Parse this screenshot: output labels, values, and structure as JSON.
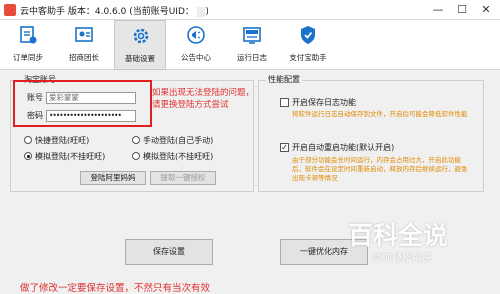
{
  "window": {
    "title": "云中客助手 版本：4.0.6.0 (当前账号UID：",
    "uid_blur": "...",
    "minimize": "—",
    "maximize": "☐",
    "close": "✕"
  },
  "tabs": [
    {
      "label": "订单同步",
      "icon": "order-sync-icon"
    },
    {
      "label": "招商团长",
      "icon": "merchant-leader-icon"
    },
    {
      "label": "基础设置",
      "icon": "settings-gear-icon",
      "active": true
    },
    {
      "label": "公告中心",
      "icon": "announcement-icon"
    },
    {
      "label": "运行日志",
      "icon": "run-log-icon"
    },
    {
      "label": "支付宝助手",
      "icon": "alipay-shield-icon"
    }
  ],
  "login": {
    "group_title": "淘宝账号",
    "account_label": "账号",
    "account_value": "爱彩蒙蒙",
    "password_label": "密码",
    "password_value": "•••••••••••••••••••••",
    "annotation": "如果出现无法登陆的问题，请更换登陆方式尝试"
  },
  "login_modes": [
    {
      "label": "快捷登陆(旺旺)",
      "selected": false
    },
    {
      "label": "手动登陆(自己手动)",
      "selected": false
    },
    {
      "label": "模拟登陆(不挂旺旺)",
      "selected": true
    },
    {
      "label": "模拟登陆(不挂旺旺)",
      "selected": false
    }
  ],
  "buttons": {
    "browser_login": "登陆阿里妈妈",
    "pull_cookie": "提取一键授权",
    "save": "保存设置",
    "optimize": "一键优化内存"
  },
  "options": {
    "group_title": "性能配置",
    "log_label": "开启保存日志功能",
    "log_checked": false,
    "log_desc": "将软件运行日志自动保存到文件，开启后可能会降低软件性能",
    "restart_label": "开启自动重启功能(默认开启)",
    "restart_checked": true,
    "restart_desc": "由于部分功能会长时间运行，内存会占用过大，开启此功能后，软件会在设定时间重新启动，释放内存后继续运行，避免出现卡顿等情况"
  },
  "bottom_notice": "做了修改一定要保存设置，不然只有当次有效",
  "watermark": {
    "main": "百科全说",
    "sub": "助你轻松解决"
  },
  "colors": {
    "accent_red": "#e02020",
    "annotation_red": "#e03030",
    "desc_orange": "#e08a00",
    "window_bg": "#f0f0f0"
  }
}
